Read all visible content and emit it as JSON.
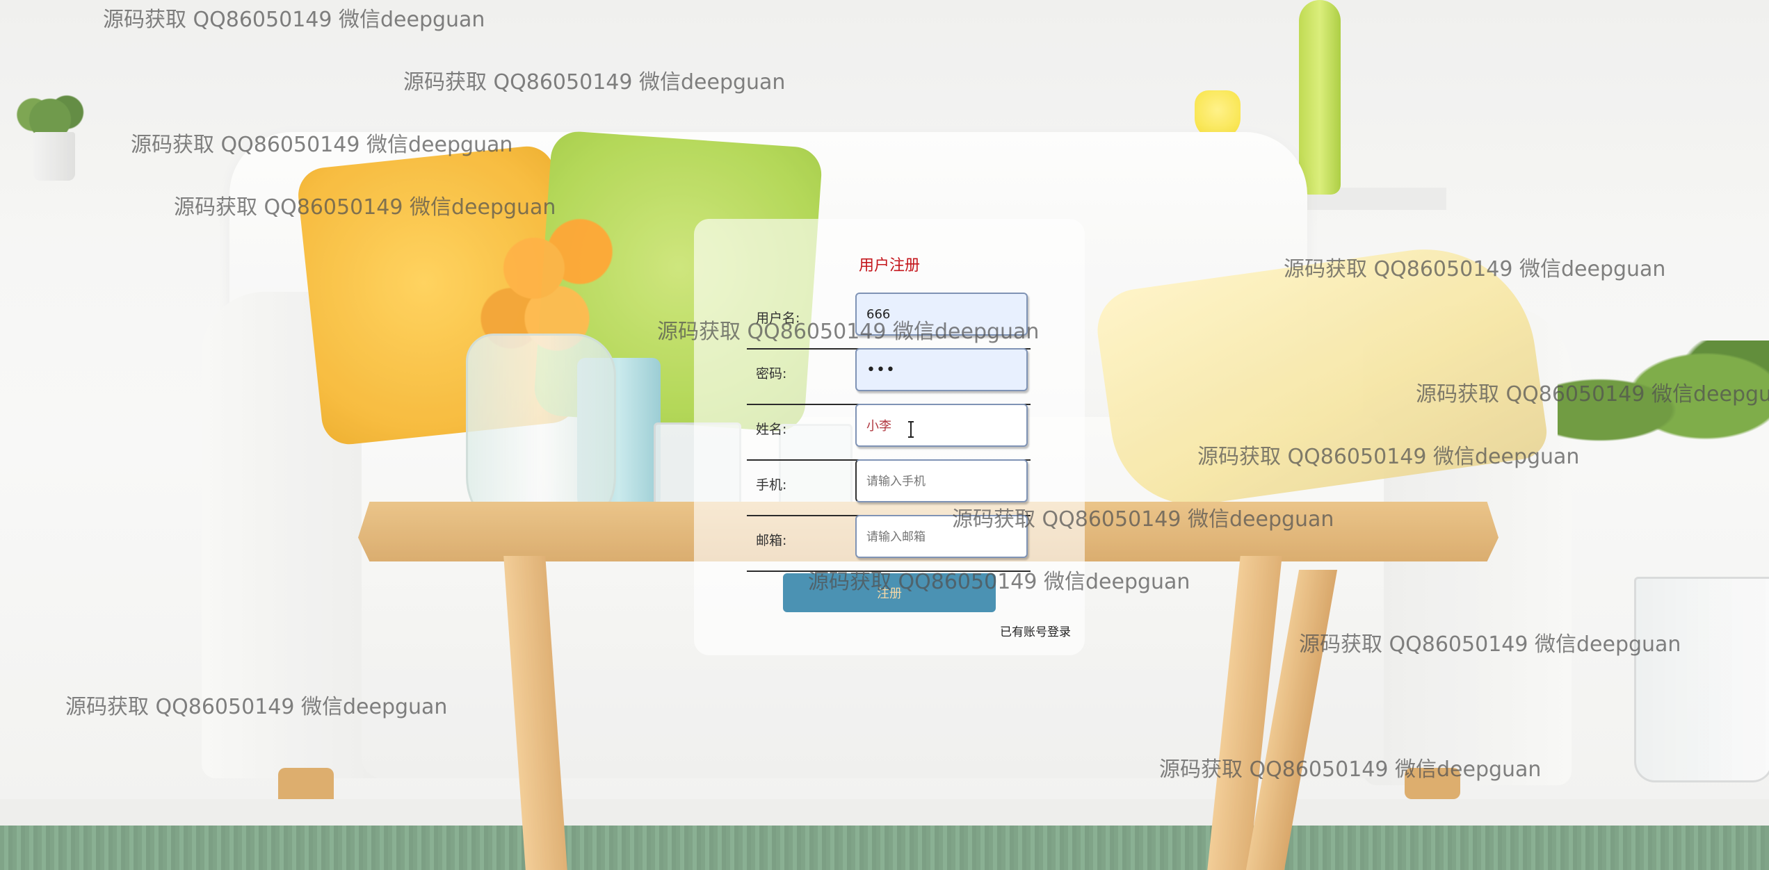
{
  "form": {
    "title": "用户注册",
    "fields": [
      {
        "label": "用户名:",
        "value": "666",
        "placeholder": "",
        "type": "text"
      },
      {
        "label": "密码:",
        "value": "•••",
        "placeholder": "",
        "type": "password"
      },
      {
        "label": "姓名:",
        "value": "小李",
        "placeholder": "",
        "type": "text"
      },
      {
        "label": "手机:",
        "value": "",
        "placeholder": "请输入手机",
        "type": "text"
      },
      {
        "label": "邮箱:",
        "value": "",
        "placeholder": "请输入邮箱",
        "type": "text"
      }
    ],
    "submit_label": "注册",
    "login_link": "已有账号登录"
  },
  "watermark_text": "源码获取 QQ86050149 微信deepguan",
  "colors": {
    "title": "#c4161c",
    "button_bg": "#4b92b3",
    "button_text": "#f5d9a8",
    "autofill_bg": "#e8f0fe"
  }
}
